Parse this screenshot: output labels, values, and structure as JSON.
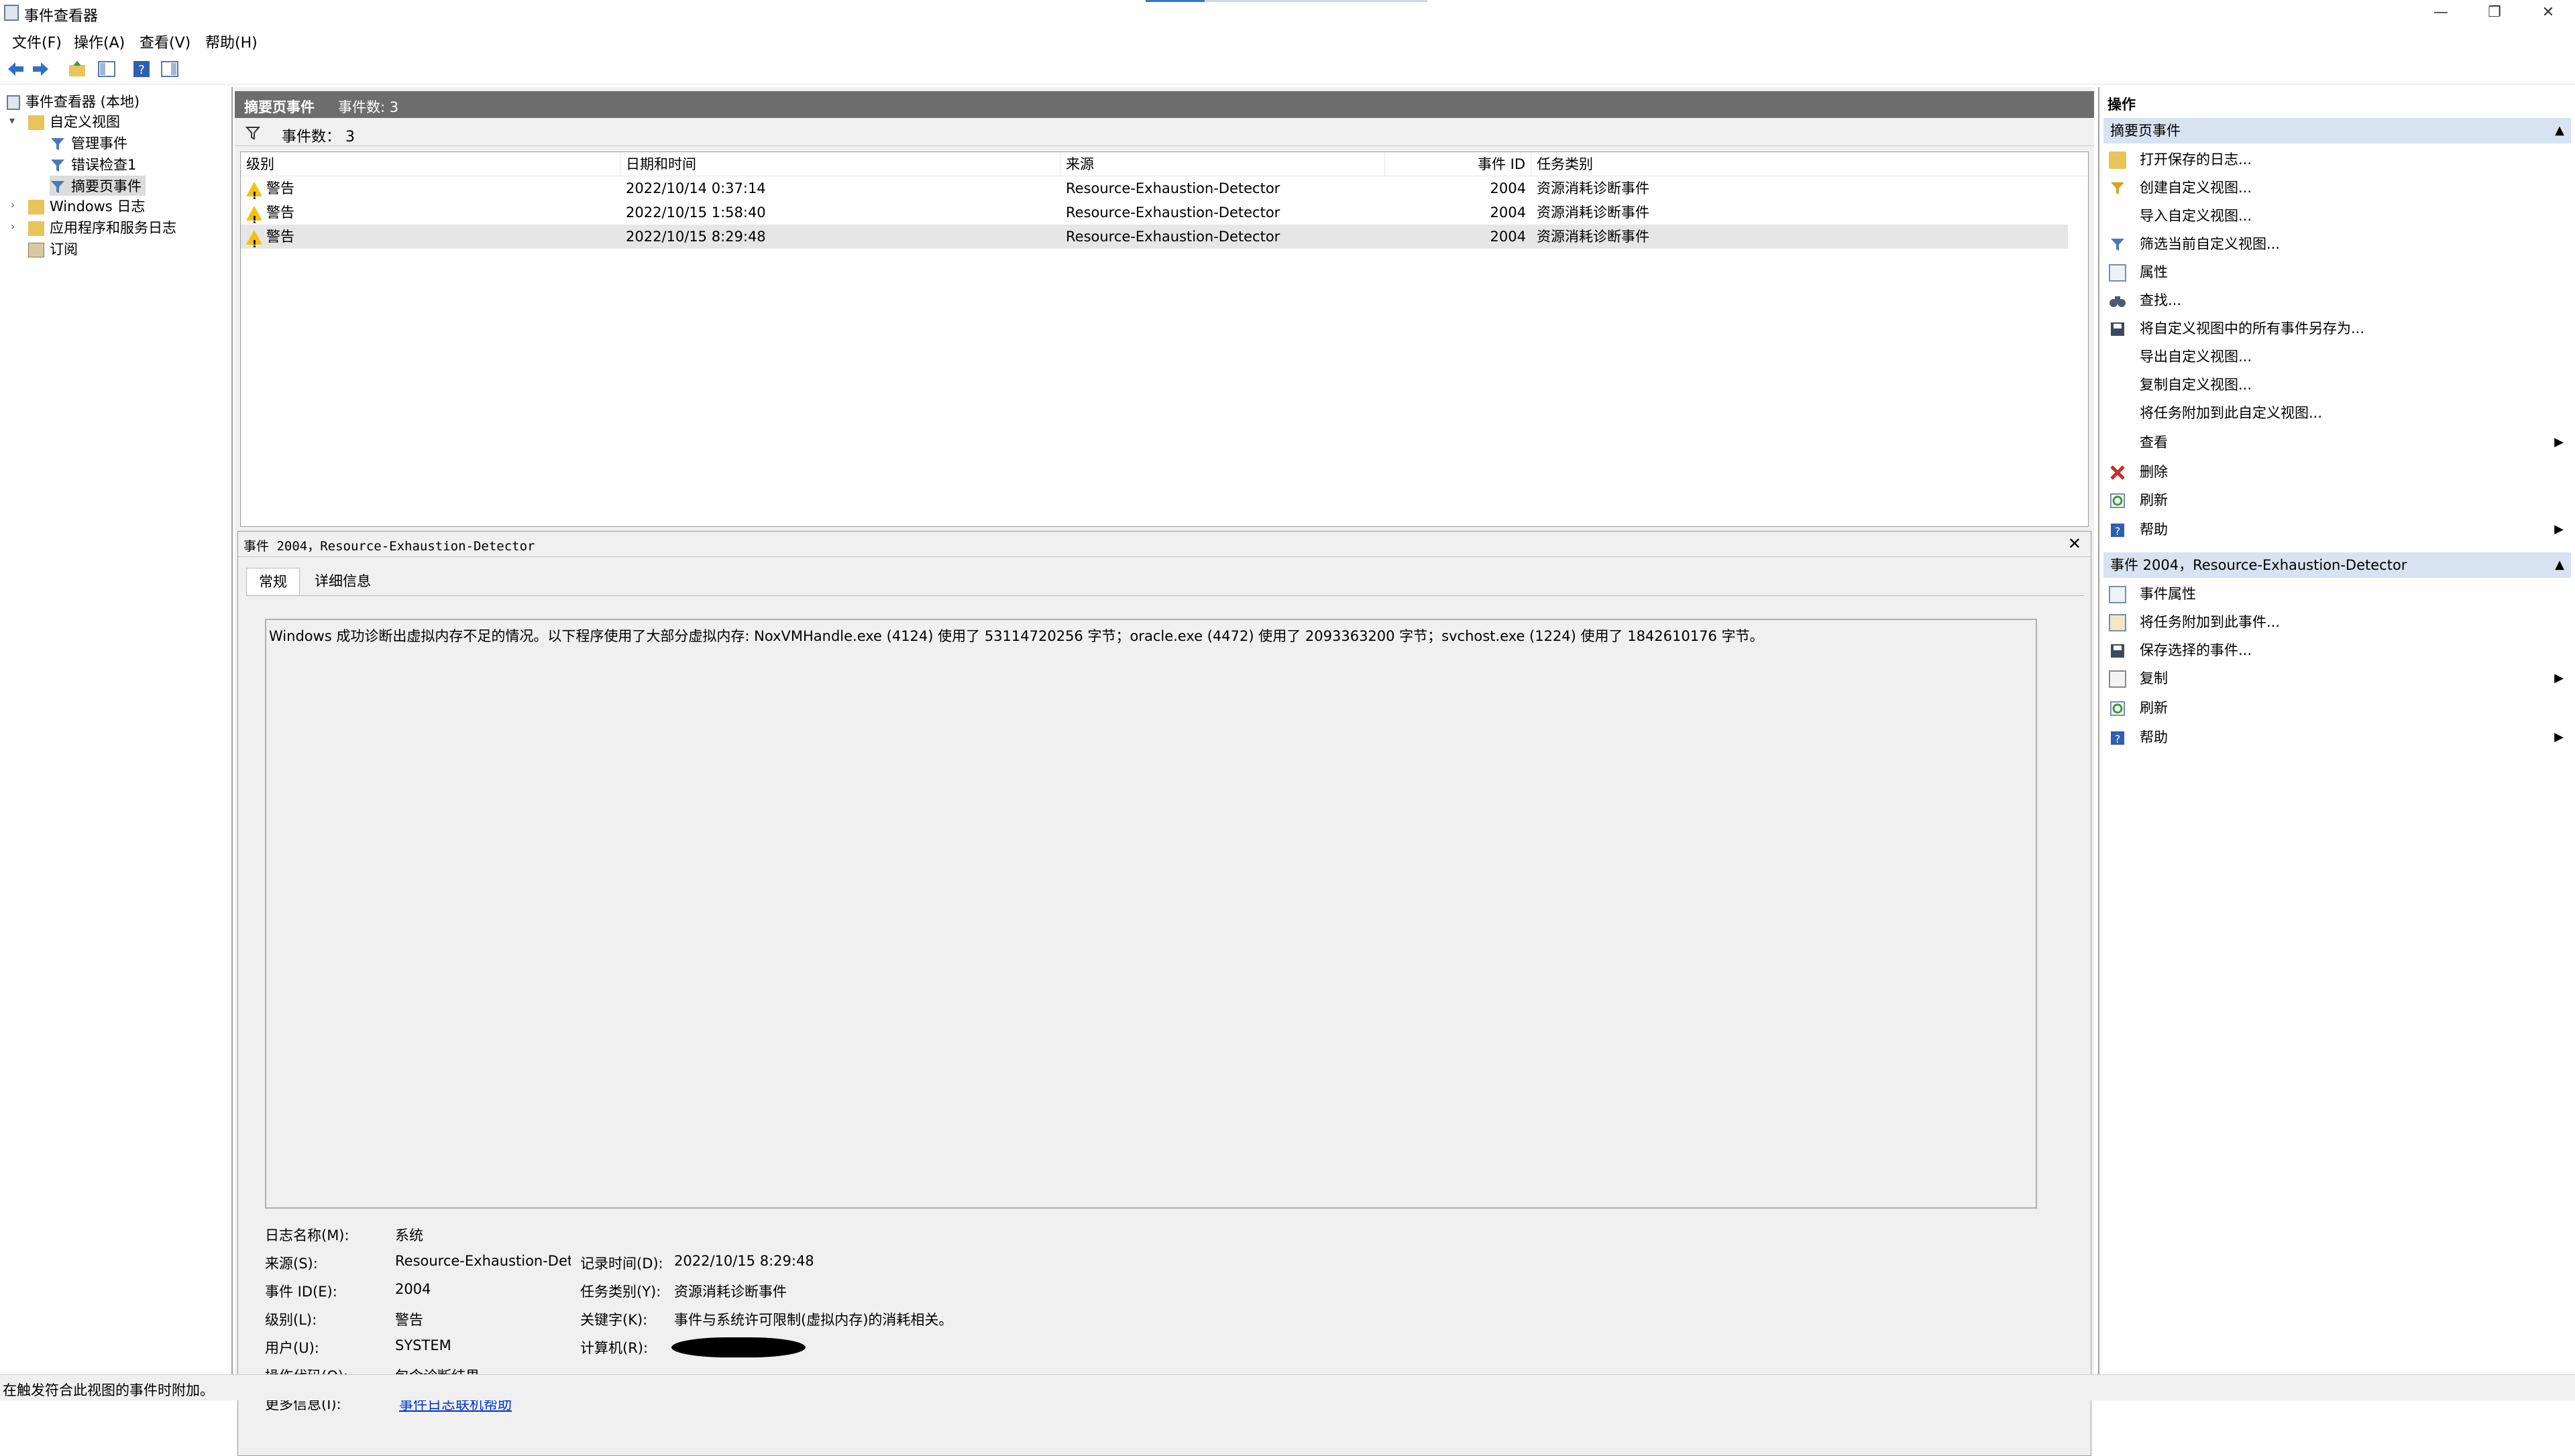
{
  "window": {
    "title": "事件查看器",
    "minimize": "—",
    "restore": "❐",
    "close": "✕"
  },
  "menu": [
    "文件(F)",
    "操作(A)",
    "查看(V)",
    "帮助(H)"
  ],
  "tree": {
    "root": "事件查看器 (本地)",
    "custom_views": "自定义视图",
    "admin_events": "管理事件",
    "error_check": "错误检查1",
    "summary_events": "摘要页事件",
    "windows_logs": "Windows 日志",
    "app_logs": "应用程序和服务日志",
    "subscriptions": "订阅"
  },
  "center": {
    "header_title": "摘要页事件",
    "header_count": "事件数: 3",
    "filter_count": "事件数： 3",
    "columns": [
      "级别",
      "日期和时间",
      "来源",
      "事件 ID",
      "任务类别"
    ],
    "rows": [
      {
        "level": "警告",
        "datetime": "2022/10/14 0:37:14",
        "source": "Resource-Exhaustion-Detector",
        "event_id": "2004",
        "category": "资源消耗诊断事件"
      },
      {
        "level": "警告",
        "datetime": "2022/10/15 1:58:40",
        "source": "Resource-Exhaustion-Detector",
        "event_id": "2004",
        "category": "资源消耗诊断事件"
      },
      {
        "level": "警告",
        "datetime": "2022/10/15 8:29:48",
        "source": "Resource-Exhaustion-Detector",
        "event_id": "2004",
        "category": "资源消耗诊断事件"
      }
    ]
  },
  "detail": {
    "header": "事件 2004，Resource-Exhaustion-Detector",
    "close": "✕",
    "tab_general": "常规",
    "tab_details": "详细信息",
    "message": "Windows 成功诊断出虚拟内存不足的情况。以下程序使用了大部分虚拟内存: NoxVMHandle.exe (4124) 使用了 53114720256 字节；oracle.exe (4472) 使用了 2093363200 字节；svchost.exe (1224) 使用了 1842610176 字节。",
    "fields": {
      "log_name_label": "日志名称(M):",
      "log_name": "系统",
      "source_label": "来源(S):",
      "source": "Resource-Exhaustion-Detec",
      "logged_label": "记录时间(D):",
      "logged": "2022/10/15 8:29:48",
      "event_id_label": "事件 ID(E):",
      "event_id": "2004",
      "task_label": "任务类别(Y):",
      "task": "资源消耗诊断事件",
      "level_label": "级别(L):",
      "level": "警告",
      "keywords_label": "关键字(K):",
      "keywords": "事件与系统许可限制(虚拟内存)的消耗相关。",
      "user_label": "用户(U):",
      "user": "SYSTEM",
      "computer_label": "计算机(R):",
      "opcode_label": "操作代码(O):",
      "opcode": "包含诊断结果。",
      "more_info_label": "更多信息(I):",
      "more_info_link": "事件日志联机帮助"
    }
  },
  "actions": {
    "title": "操作",
    "section1": "摘要页事件",
    "items1": [
      "打开保存的日志...",
      "创建自定义视图...",
      "导入自定义视图...",
      "筛选当前自定义视图...",
      "属性",
      "查找...",
      "将自定义视图中的所有事件另存为...",
      "导出自定义视图...",
      "复制自定义视图...",
      "将任务附加到此自定义视图...",
      "查看",
      "删除",
      "刷新",
      "帮助"
    ],
    "section2": "事件 2004，Resource-Exhaustion-Detector",
    "items2": [
      "事件属性",
      "将任务附加到此事件...",
      "保存选择的事件...",
      "复制",
      "刷新",
      "帮助"
    ]
  },
  "status": "在触发符合此视图的事件时附加。",
  "colors": {
    "header_gray": "#6d6d6d",
    "section_blue": "#d7e3f1",
    "warning_yellow": "#f4c20d",
    "link_blue": "#0033cc"
  }
}
